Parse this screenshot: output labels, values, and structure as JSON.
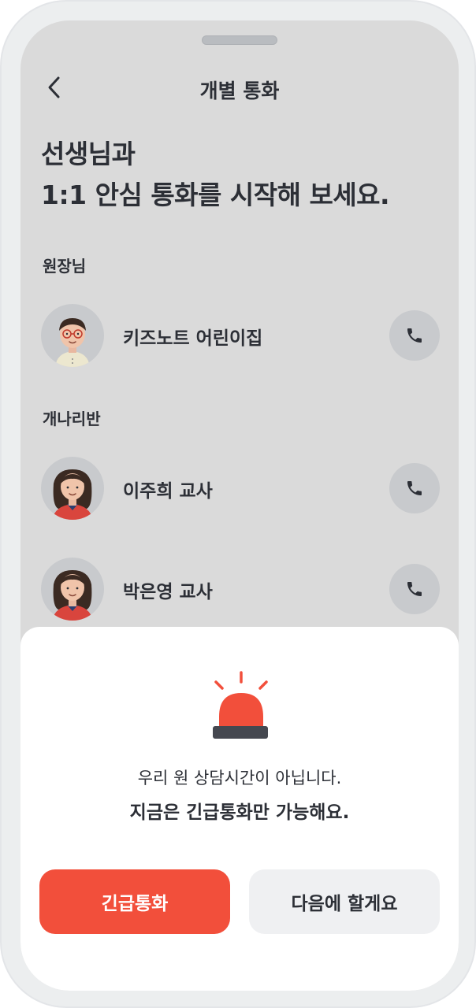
{
  "header": {
    "title": "개별 통화"
  },
  "headline": {
    "line1": "선생님과",
    "line2": "1:1 안심 통화를 시작해 보세요."
  },
  "groups": [
    {
      "label": "원장님",
      "contacts": [
        {
          "name": "키즈노트 어린이집"
        }
      ]
    },
    {
      "label": "개나리반",
      "contacts": [
        {
          "name": "이주희 교사"
        },
        {
          "name": "박은영 교사"
        }
      ]
    }
  ],
  "sheet": {
    "notice_line1": "우리 원 상담시간이 아닙니다.",
    "notice_line2": "지금은 긴급통화만 가능해요.",
    "emergency_label": "긴급통화",
    "later_label": "다음에 할게요"
  },
  "colors": {
    "accent": "#f24f3b",
    "overlay": "#dadada",
    "text": "#2c2f36"
  },
  "icons": {
    "back": "chevron-left-icon",
    "call": "phone-icon",
    "siren": "siren-icon"
  }
}
